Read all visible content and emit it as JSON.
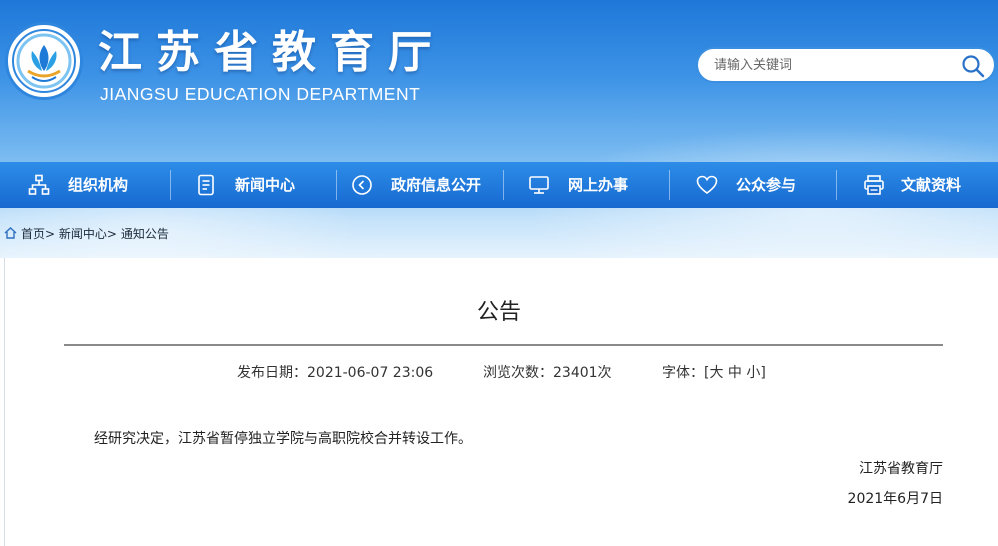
{
  "header": {
    "title": "江苏省教育厅",
    "subtitle": "JIANGSU EDUCATION DEPARTMENT",
    "logo": "education-department-emblem"
  },
  "search": {
    "placeholder": "请输入关键词",
    "icon": "search-icon"
  },
  "nav": {
    "items": [
      {
        "label": "组织机构",
        "icon": "org-chart-icon"
      },
      {
        "label": "新闻中心",
        "icon": "document-icon"
      },
      {
        "label": "政府信息公开",
        "icon": "play-circle-icon"
      },
      {
        "label": "网上办事",
        "icon": "monitor-icon"
      },
      {
        "label": "公众参与",
        "icon": "heart-icon"
      },
      {
        "label": "文献资料",
        "icon": "printer-icon"
      }
    ]
  },
  "breadcrumb": {
    "home": "首页",
    "sep": ">",
    "level1": "新闻中心",
    "level2": "通知公告"
  },
  "article": {
    "title": "公告",
    "publish_date": "发布日期：2021-06-07 23:06",
    "views": "浏览次数：23401次",
    "font_label": "字体：[",
    "font_large": "大",
    "font_medium": "中",
    "font_small": "小",
    "font_close": "]",
    "body": "经研究决定，江苏省暂停独立学院与高职院校合并转设工作。",
    "signature_org": "江苏省教育厅",
    "signature_date": "2021年6月7日"
  },
  "colors": {
    "nav_blue": "#1669d0",
    "banner_blue": "#1e78d8",
    "search_border": "#3b8fe0"
  }
}
